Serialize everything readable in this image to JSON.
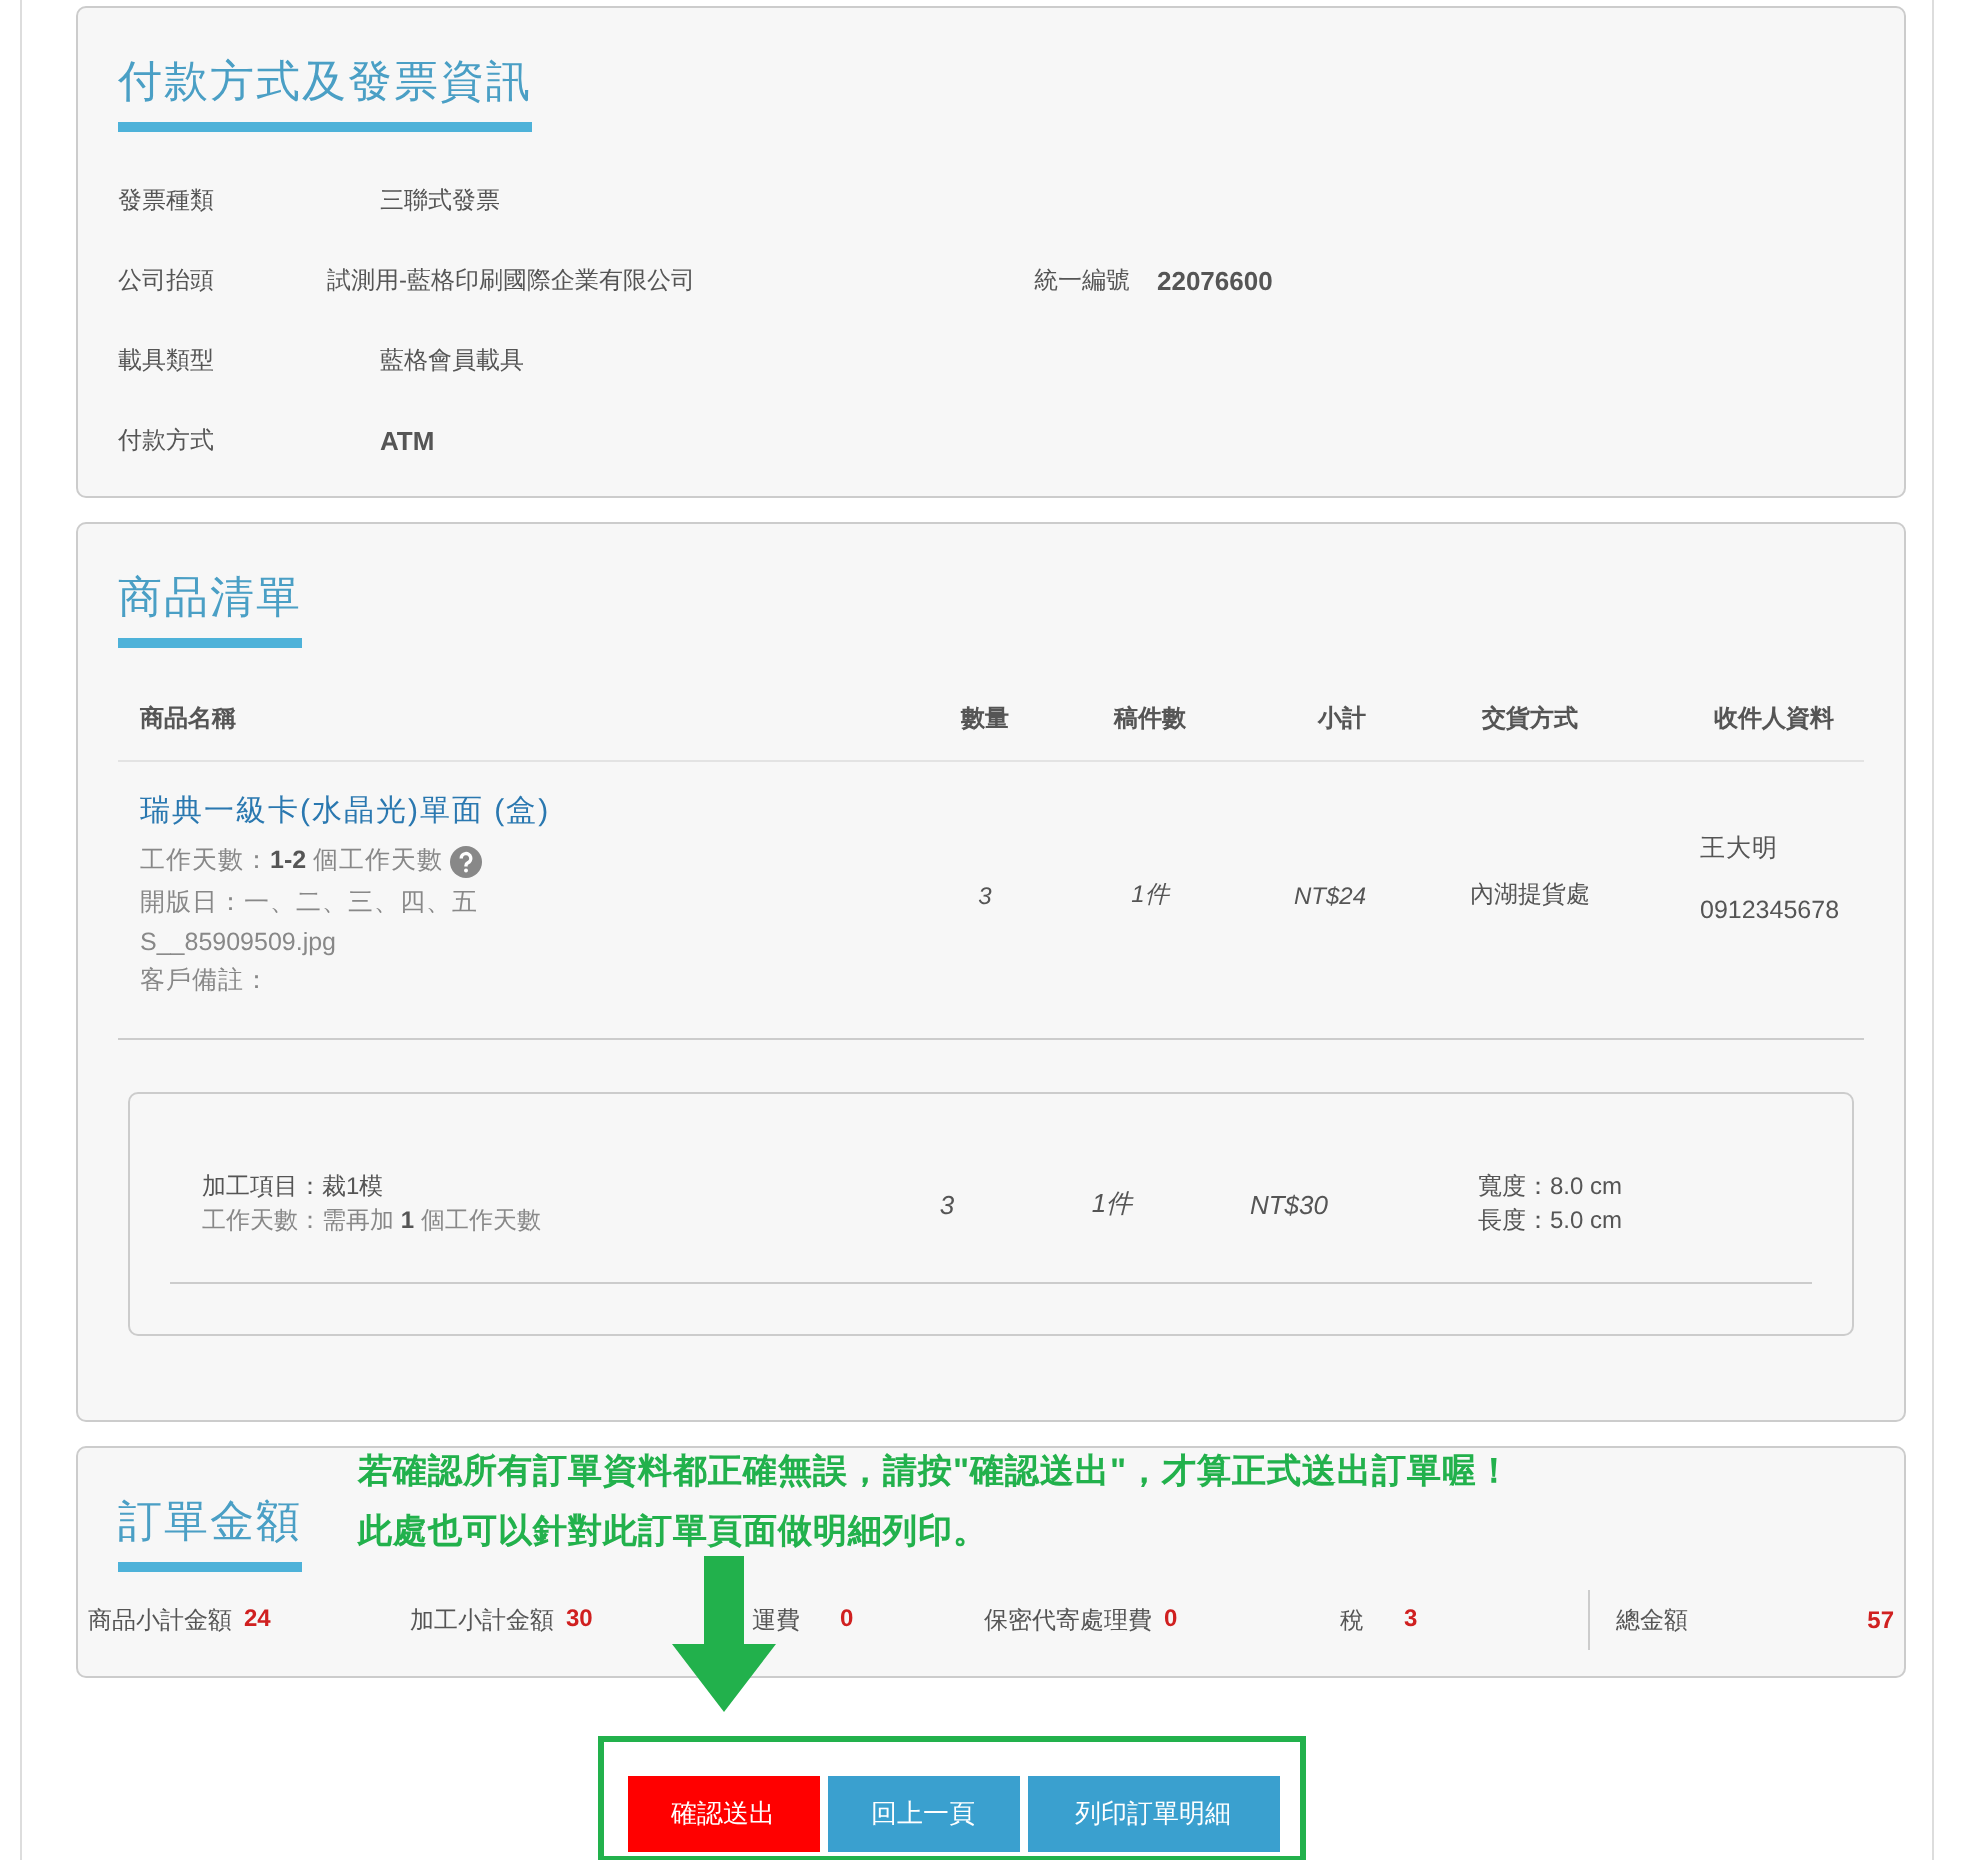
{
  "invoice_section": {
    "title": "付款方式及發票資訊",
    "fields": [
      {
        "label": "發票種類",
        "value": "三聯式發票",
        "emphasis": false
      },
      {
        "label": "公司抬頭",
        "value": "試測用-藍格印刷國際企業有限公司",
        "emphasis": false,
        "side": {
          "label": "統一編號",
          "value": "22076600",
          "emphasis": true
        }
      },
      {
        "label": "載具類型",
        "value": "藍格會員載具",
        "emphasis": false
      },
      {
        "label": "付款方式",
        "value": "ATM",
        "emphasis": true
      }
    ]
  },
  "product_section": {
    "title": "商品清單",
    "columns": [
      "商品名稱",
      "數量",
      "稿件數",
      "小計",
      "交貨方式",
      "收件人資料"
    ],
    "items": [
      {
        "name": "瑞典一級卡(水晶光)單面 (盒)",
        "details": [
          {
            "text": "工作天數：**1-2** 個工作天數",
            "kind": "help"
          },
          {
            "text": "開版日：一、二、三、四、五",
            "kind": "plain"
          },
          {
            "text": "S__85909509.jpg",
            "kind": "plain"
          },
          {
            "text": "客戶備註：",
            "kind": "plain"
          }
        ],
        "qty": "3",
        "drafts": "1件",
        "subtotal": "NT$24",
        "delivery": "內湖提貨處",
        "recipient": [
          "王大明",
          "0912345678"
        ]
      }
    ],
    "processing": [
      {
        "lines": [
          "加工項目：裁1模",
          "工作天數：需再加 **1** 個工作天數"
        ],
        "qty": "3",
        "drafts": "1件",
        "subtotal": "NT$30",
        "specs": [
          "寬度：8.0 cm",
          "長度：5.0 cm"
        ]
      }
    ]
  },
  "amount_section": {
    "title": "訂單金額",
    "items": [
      {
        "label": "商品小計金額",
        "value": "24"
      },
      {
        "label": "加工小計金額",
        "value": "30"
      },
      {
        "label": "運費",
        "value": "0"
      },
      {
        "label": "保密代寄處理費",
        "value": "0"
      },
      {
        "label": "稅",
        "value": "3"
      }
    ],
    "total": {
      "label": "總金額",
      "value": "57"
    }
  },
  "annotation": {
    "lines": [
      "若確認所有訂單資料都正確無誤，請按\"確認送出\"，才算正式送出訂單喔！",
      "此處也可以針對此訂單頁面做明細列印。"
    ]
  },
  "buttons": [
    {
      "label": "確認送出",
      "kind": "danger"
    },
    {
      "label": "回上一頁",
      "kind": "primary"
    },
    {
      "label": "列印訂單明細",
      "kind": "primary"
    }
  ]
}
